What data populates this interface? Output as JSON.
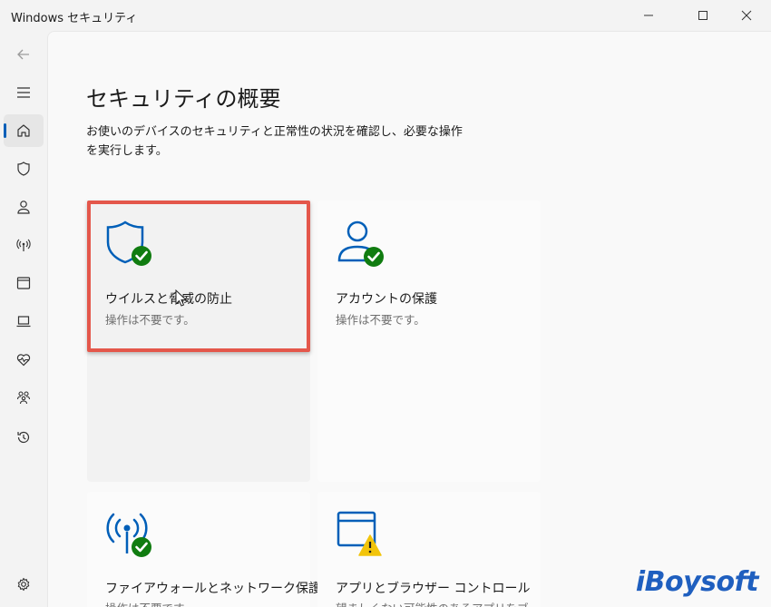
{
  "window": {
    "title": "Windows セキュリティ",
    "minimize_icon": "minimize-icon",
    "maximize_icon": "maximize-icon",
    "close_icon": "close-icon"
  },
  "sidebar": {
    "items": [
      {
        "name": "back",
        "icon": "back-arrow-icon"
      },
      {
        "name": "menu",
        "icon": "hamburger-menu-icon"
      },
      {
        "name": "home",
        "icon": "home-icon",
        "active": true
      },
      {
        "name": "virus-protection",
        "icon": "shield-icon"
      },
      {
        "name": "account-protection",
        "icon": "person-icon"
      },
      {
        "name": "firewall",
        "icon": "wireless-antenna-icon"
      },
      {
        "name": "app-browser",
        "icon": "app-window-icon"
      },
      {
        "name": "device-security",
        "icon": "laptop-icon"
      },
      {
        "name": "device-health",
        "icon": "heart-pulse-icon"
      },
      {
        "name": "family",
        "icon": "family-icon"
      },
      {
        "name": "history",
        "icon": "history-icon"
      },
      {
        "name": "settings",
        "icon": "gear-icon"
      }
    ]
  },
  "main": {
    "title": "セキュリティの概要",
    "description": "お使いのデバイスのセキュリティと正常性の状況を確認し、必要な操作を実行します。",
    "tiles": [
      {
        "title": "ウイルスと脅威の防止",
        "status": "操作は不要です。",
        "icon": "shield-check-icon",
        "badge": "ok"
      },
      {
        "title": "アカウントの保護",
        "status": "操作は不要です。",
        "icon": "person-check-icon",
        "badge": "ok"
      },
      {
        "title": "ファイアウォールとネットワーク保護",
        "status": "操作は不要です。",
        "icon": "antenna-check-icon",
        "badge": "ok"
      },
      {
        "title": "アプリとブラウザー コントロール",
        "status": "望ましくない可能性のあるアプリをブ",
        "icon": "app-window-warning-icon",
        "badge": "warning"
      }
    ]
  },
  "watermark": "iBoysoft",
  "colors": {
    "accent": "#005fb8",
    "ok_green": "#107c10",
    "warning_yellow": "#f2c40a",
    "highlight_border": "#e4574b",
    "watermark_blue": "#1f5fbf"
  }
}
